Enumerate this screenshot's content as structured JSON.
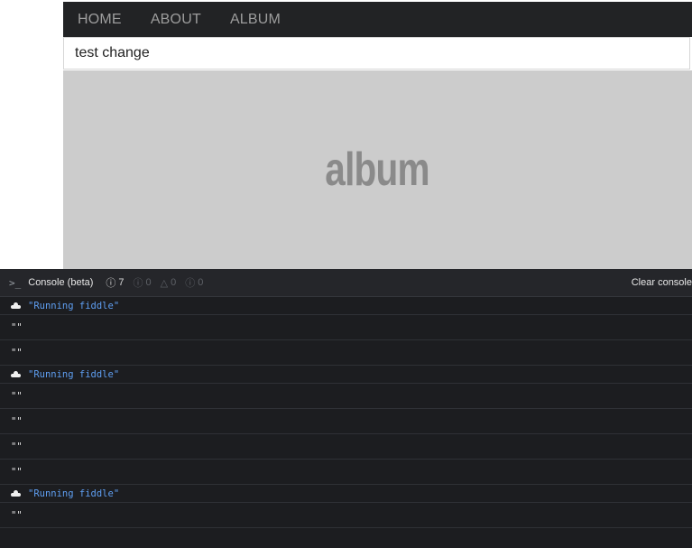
{
  "preview": {
    "nav": [
      {
        "label": "HOME",
        "name": "nav-home"
      },
      {
        "label": "ABOUT",
        "name": "nav-about"
      },
      {
        "label": "ALBUM",
        "name": "nav-album"
      }
    ],
    "text_value": "test change",
    "album_label": "album"
  },
  "console": {
    "title": "Console (beta)",
    "counts": {
      "log": "7",
      "info": "0",
      "warn": "0",
      "error": "0"
    },
    "clear_label": "Clear console",
    "entries": [
      {
        "type": "info",
        "text": "\"Running fiddle\""
      },
      {
        "type": "empty",
        "text": "\"\""
      },
      {
        "type": "empty",
        "text": "\"\""
      },
      {
        "type": "info",
        "text": "\"Running fiddle\""
      },
      {
        "type": "empty",
        "text": "\"\""
      },
      {
        "type": "empty",
        "text": "\"\""
      },
      {
        "type": "empty",
        "text": "\"\""
      },
      {
        "type": "empty",
        "text": "\"\""
      },
      {
        "type": "info",
        "text": "\"Running fiddle\""
      },
      {
        "type": "empty",
        "text": "\"\""
      }
    ],
    "colors": {
      "background": "#1c1d20",
      "info_text": "#5f9ff2"
    }
  }
}
